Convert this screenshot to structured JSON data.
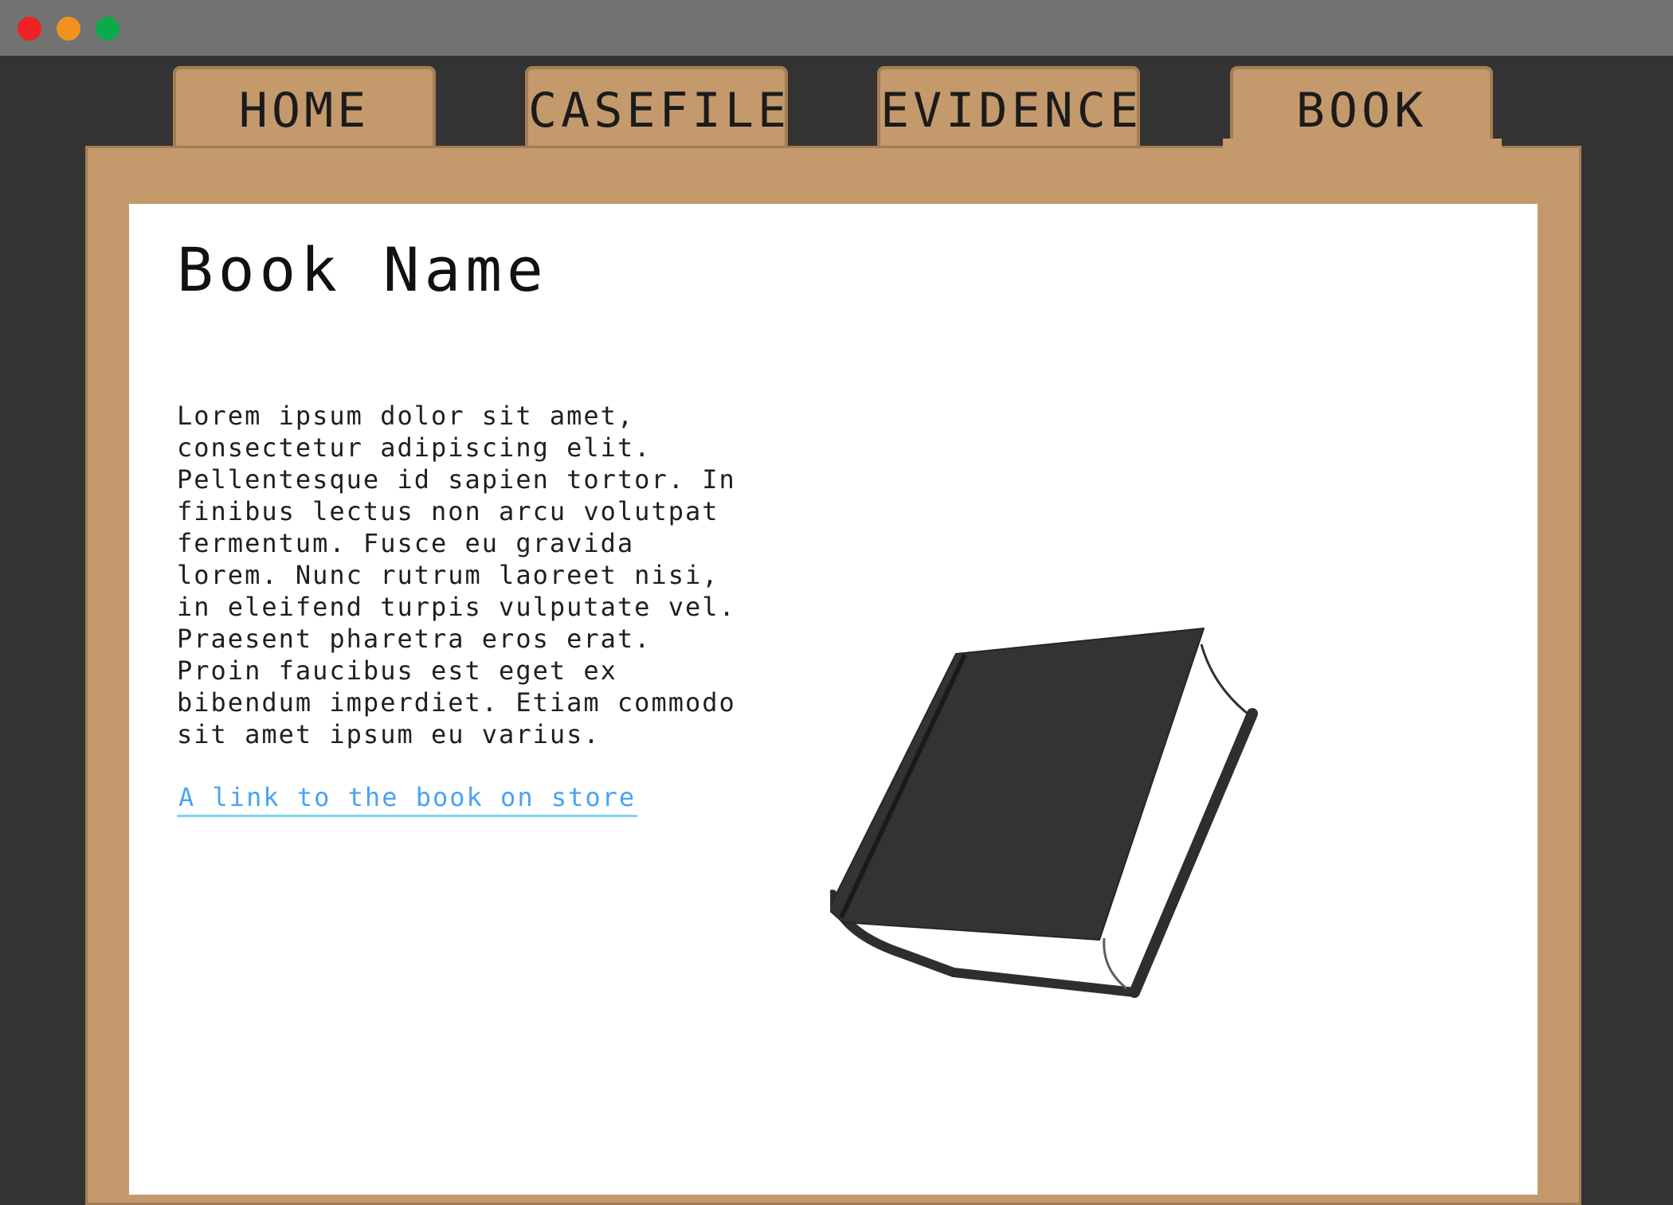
{
  "window": {
    "controls": [
      "close",
      "minimize",
      "maximize"
    ],
    "control_colors": [
      "#ee2125",
      "#f39220",
      "#0daa4b"
    ]
  },
  "tabs": [
    {
      "label": "HOME",
      "active": false
    },
    {
      "label": "CASEFILE",
      "active": false
    },
    {
      "label": "EVIDENCE",
      "active": false
    },
    {
      "label": "BOOK",
      "active": true
    }
  ],
  "colors": {
    "folder": "#c49a6c",
    "background": "#333333",
    "link": "#4aa3f3"
  },
  "book": {
    "title": "Book Name",
    "description": "Lorem ipsum dolor sit amet, consectetur adipiscing elit. Pellentesque id sapien tortor. In finibus lectus non arcu volutpat fermentum. Fusce eu gravida lorem. Nunc rutrum laoreet nisi, in eleifend turpis vulputate vel. Praesent pharetra eros erat. Proin faucibus est eget ex bibendum imperdiet. Etiam commodo sit amet ipsum eu varius.",
    "store_link_text": "A link to the book on store",
    "image_icon": "book-illustration"
  }
}
